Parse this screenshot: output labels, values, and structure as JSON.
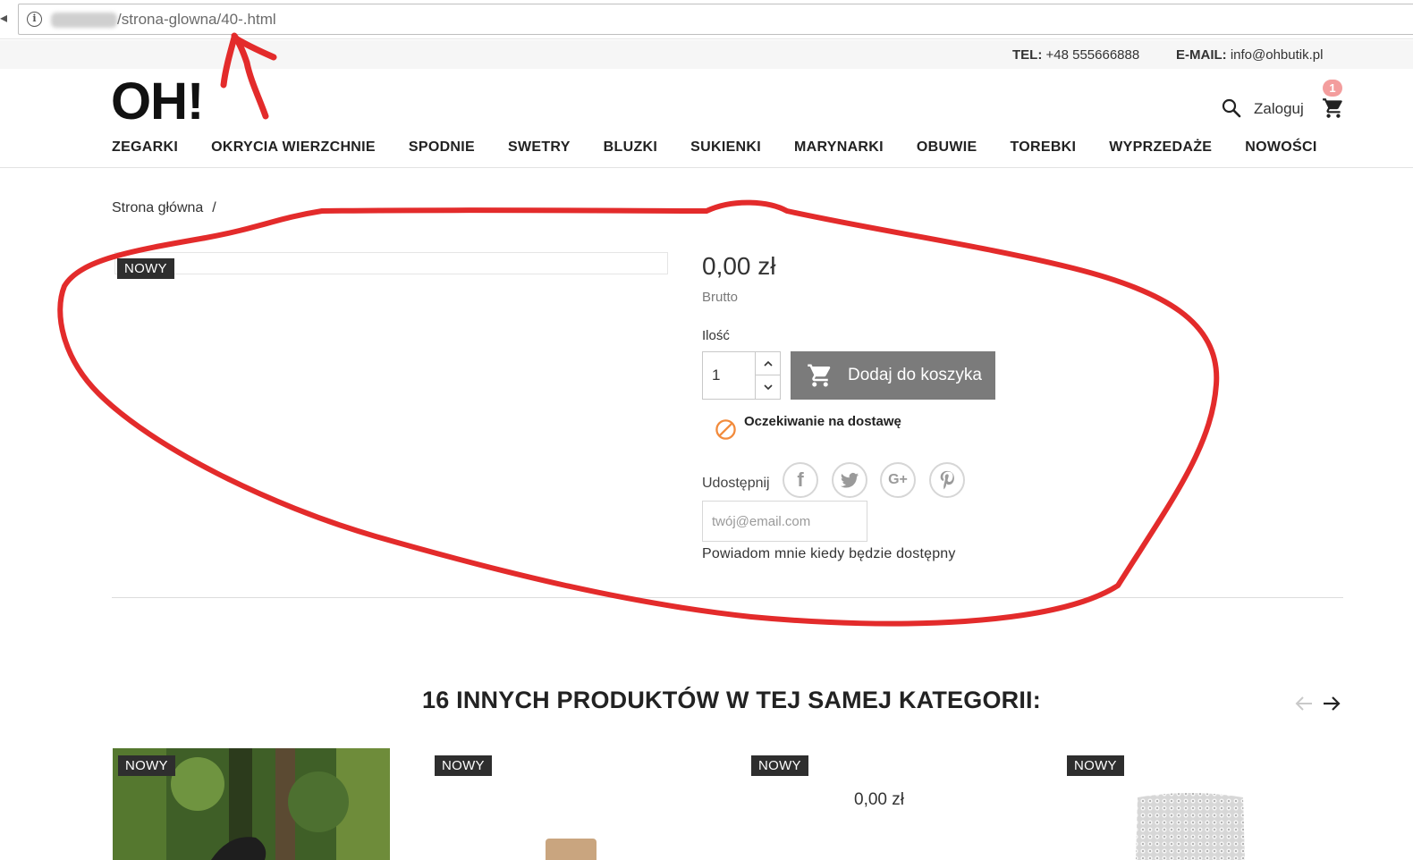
{
  "browser": {
    "back_fragment": "◂",
    "url_visible": "/strona-glowna/40-.html"
  },
  "topbar": {
    "tel_label": "TEL:",
    "tel_value": "+48 555666888",
    "email_label": "E-MAIL:",
    "email_value": "info@ohbutik.pl"
  },
  "header": {
    "logo": "OH!",
    "login_label": "Zaloguj",
    "cart_count": "1"
  },
  "nav": {
    "items": [
      "ZEGARKI",
      "OKRYCIA WIERZCHNIE",
      "SPODNIE",
      "SWETRY",
      "BLUZKI",
      "SUKIENKI",
      "MARYNARKI",
      "OBUWIE",
      "TOREBKI",
      "WYPRZEDAŻE",
      "NOWOŚCI"
    ]
  },
  "breadcrumb": {
    "home": "Strona główna",
    "separator": "/"
  },
  "product": {
    "badge": "NOWY",
    "price": "0,00 zł",
    "tax_label": "Brutto",
    "quantity_label": "Ilość",
    "quantity_value": "1",
    "add_to_cart": "Dodaj do koszyka",
    "availability": "Oczekiwanie na dostawę",
    "share_label": "Udostępnij",
    "email_placeholder": "twój@email.com",
    "notify_text": "Powiadom mnie kiedy będzie dostępny"
  },
  "related": {
    "title": "16 INNYCH PRODUKTÓW W TEJ SAMEJ KATEGORII:",
    "cards": [
      {
        "badge": "NOWY"
      },
      {
        "badge": "NOWY"
      },
      {
        "badge": "NOWY",
        "price": "0,00 zł"
      },
      {
        "badge": "NOWY"
      }
    ]
  },
  "colors": {
    "annotation": "#e32b2b",
    "button": "#7b7b7b",
    "badge": "#2e2e2e",
    "cart_badge": "#f39d9d",
    "availability_icon": "#f28b3c"
  },
  "icons": [
    "info-icon",
    "search-icon",
    "cart-icon",
    "facebook-icon",
    "twitter-icon",
    "google-plus-icon",
    "pinterest-icon",
    "arrow-left-icon",
    "arrow-right-icon",
    "unavailable-icon"
  ]
}
